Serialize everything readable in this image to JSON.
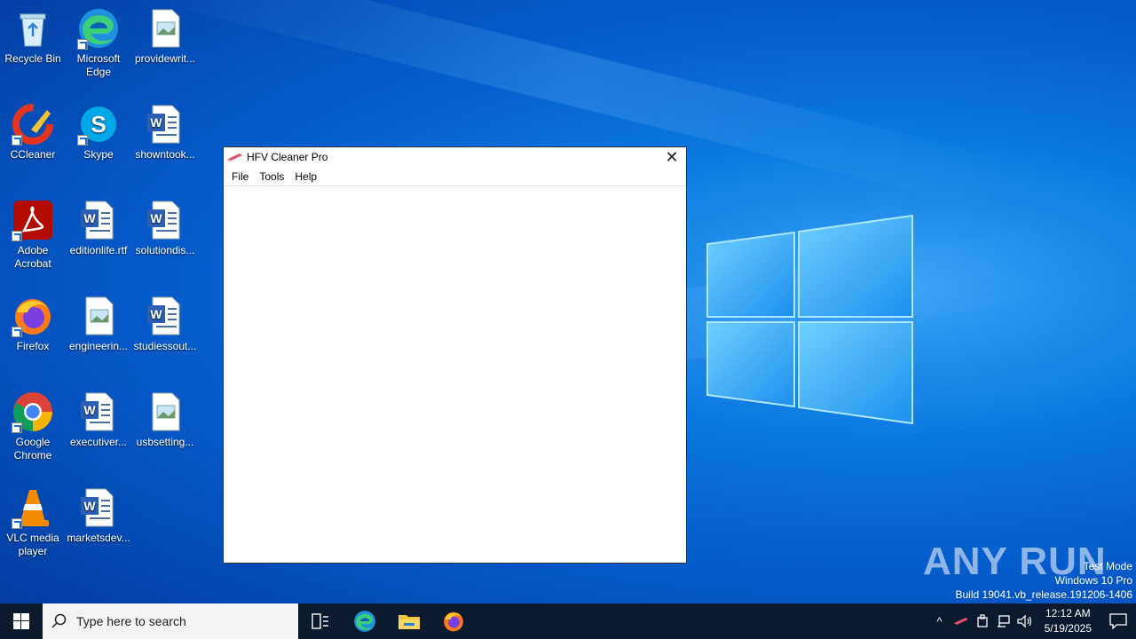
{
  "desktop": {
    "icons": [
      {
        "label": "Recycle Bin"
      },
      {
        "label": "Microsoft Edge"
      },
      {
        "label": "providewrit..."
      },
      {
        "label": "CCleaner"
      },
      {
        "label": "Skype"
      },
      {
        "label": "showntook..."
      },
      {
        "label": "Adobe Acrobat"
      },
      {
        "label": "editionlife.rtf"
      },
      {
        "label": "solutiondis..."
      },
      {
        "label": "Firefox"
      },
      {
        "label": "engineerin..."
      },
      {
        "label": "studiessout..."
      },
      {
        "label": "Google Chrome"
      },
      {
        "label": "executiver..."
      },
      {
        "label": "usbsetting..."
      },
      {
        "label": "VLC media player"
      },
      {
        "label": "marketsdev..."
      }
    ]
  },
  "window": {
    "title": "HFV Cleaner Pro",
    "close_glyph": "✕",
    "menu": [
      "File",
      "Tools",
      "Help"
    ]
  },
  "watermark": {
    "brand": "ANY RUN",
    "line1": "Test Mode",
    "line2": "Windows 10 Pro",
    "line3": "Build 19041.vb_release.191206-1406"
  },
  "taskbar": {
    "search_placeholder": "Type here to search",
    "time": "12:12 AM",
    "date": "5/19/2025",
    "tray_chevron": "^",
    "accent": "#0c1a2e"
  }
}
